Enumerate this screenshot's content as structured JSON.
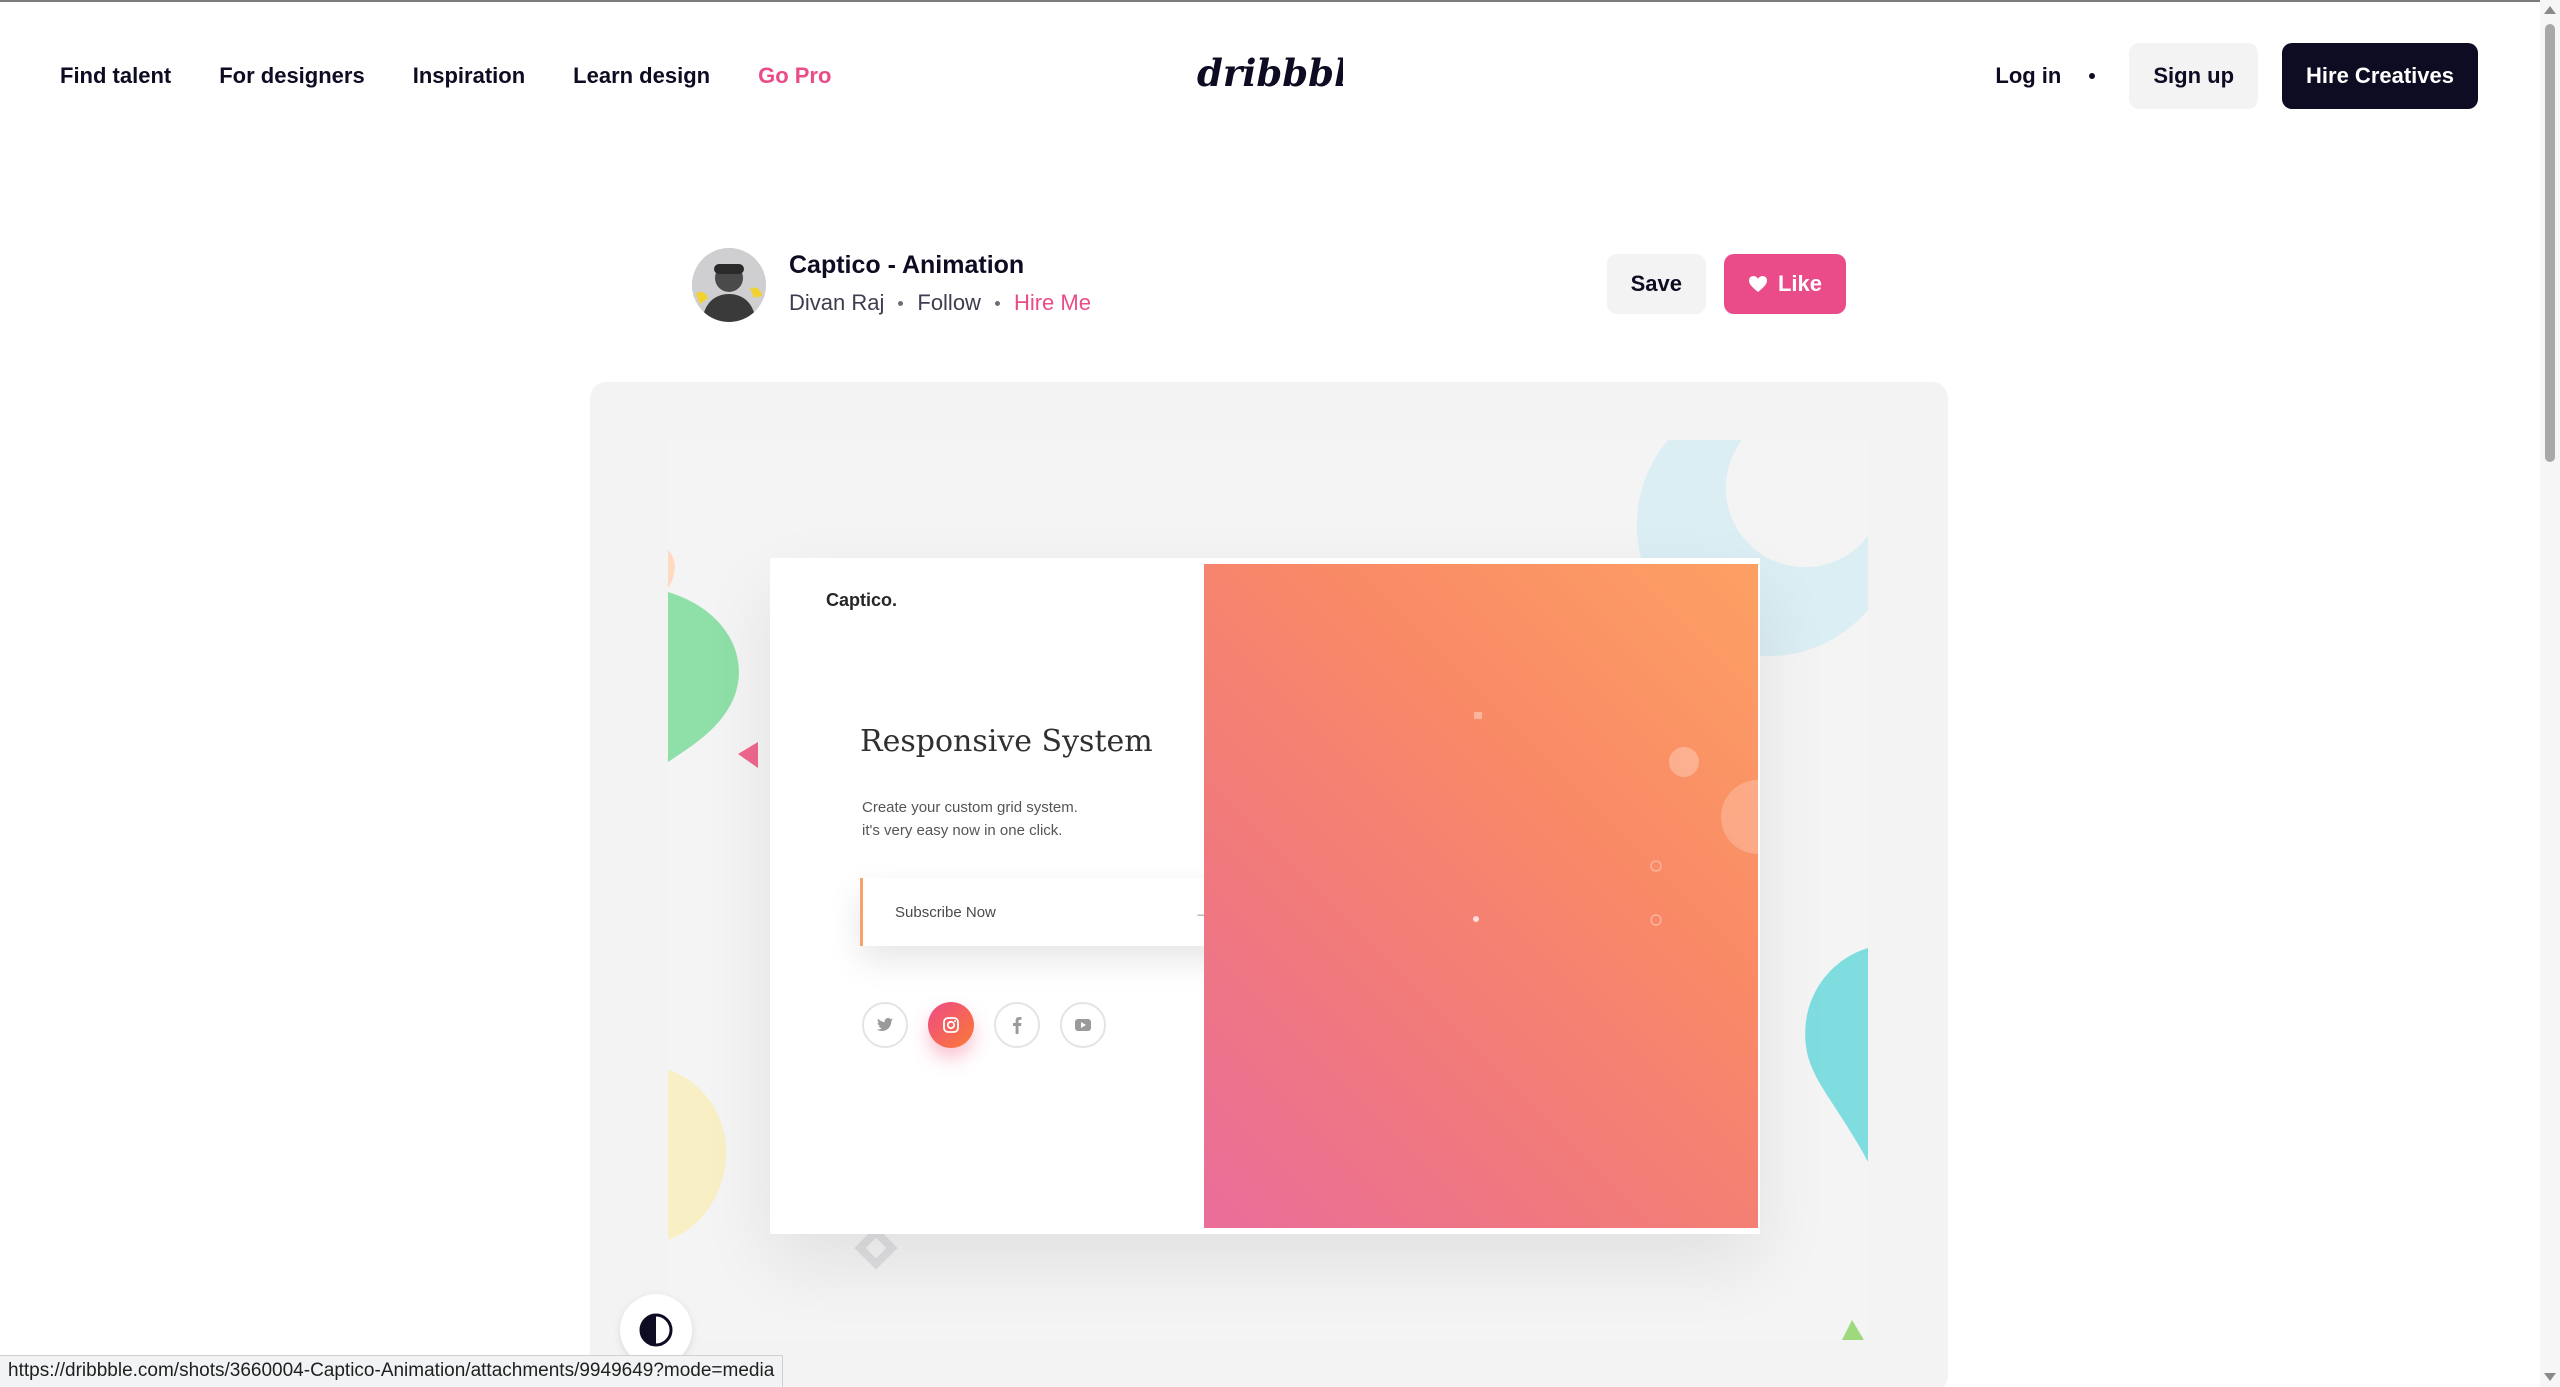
{
  "nav": {
    "links": [
      "Find talent",
      "For designers",
      "Inspiration",
      "Learn design",
      "Go Pro"
    ],
    "logo_text": "dribbble",
    "login": "Log in",
    "signup": "Sign up",
    "hire": "Hire Creatives"
  },
  "shot": {
    "title": "Captico - Animation",
    "author": "Divan Raj",
    "follow": "Follow",
    "hire_me": "Hire Me",
    "save": "Save",
    "like": "Like"
  },
  "preview": {
    "brand": "Captico.",
    "heading": "Responsive System",
    "text_line1": "Create your custom grid system.",
    "text_line2": "it's very easy now in one click.",
    "subscribe": "Subscribe Now",
    "social_icons": [
      "twitter-icon",
      "instagram-icon",
      "facebook-icon",
      "youtube-icon"
    ]
  },
  "status_url": "https://dribbble.com/shots/3660004-Captico-Animation/attachments/9949649?mode=media",
  "colors": {
    "brand_pink": "#ea4c89",
    "dark": "#0d0c22",
    "gradient_orange": "#fda064",
    "gradient_pink": "#ea6d9b"
  }
}
